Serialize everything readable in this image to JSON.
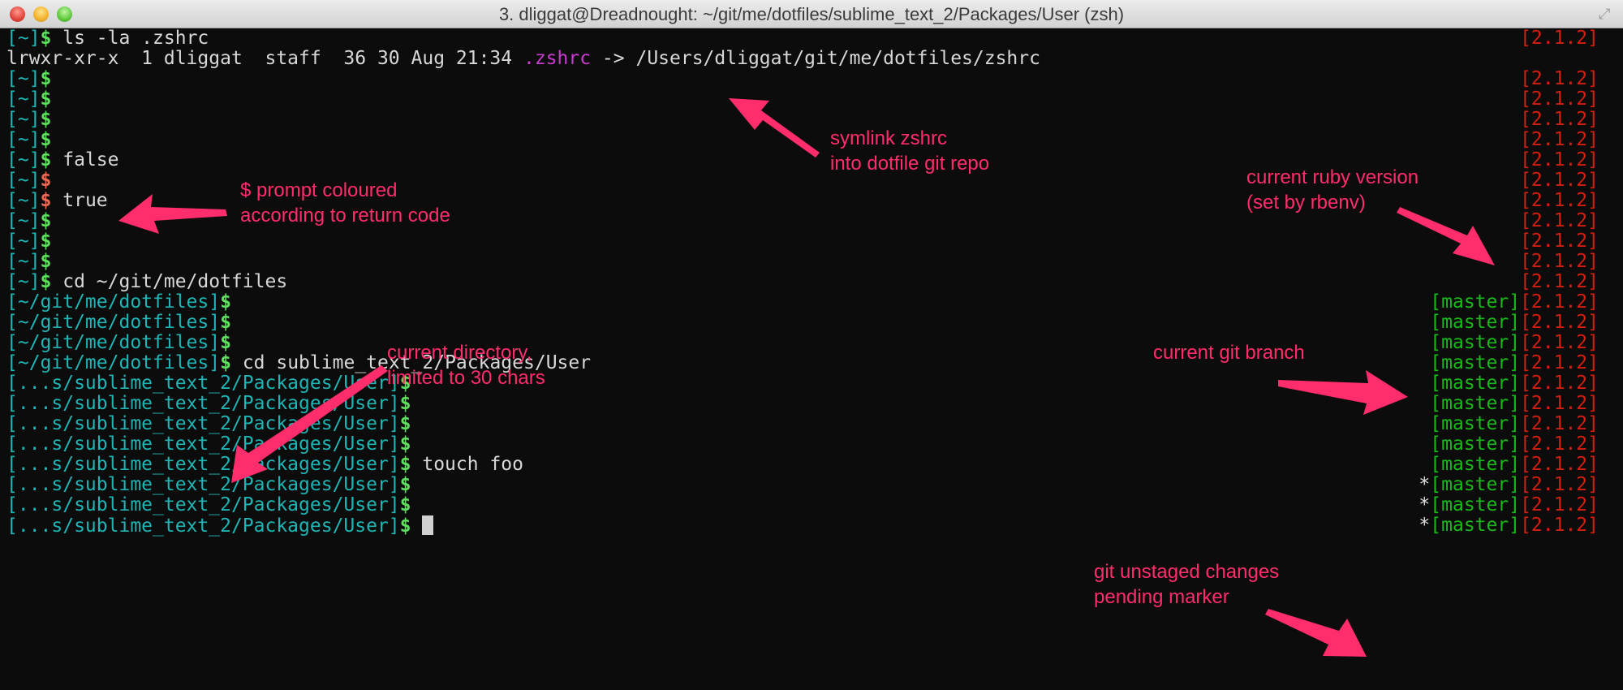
{
  "window": {
    "title": "3. dliggat@Dreadnought: ~/git/me/dotfiles/sublime_text_2/Packages/User (zsh)",
    "buttons": [
      "close",
      "minimize",
      "zoom"
    ]
  },
  "terminal": {
    "ruby_version": "[2.1.2]",
    "git_branch": "[master]",
    "dirty_marker": "*",
    "lines": [
      {
        "dir": "[~]",
        "sym": "$",
        "sym_color": "green",
        "cmd": " ls -la .zshrc",
        "branch": false,
        "dirty": false
      },
      {
        "output": "lrwxr-xr-x  1 dliggat  staff  36 30 Aug 21:34 ",
        "output_link": ".zshrc",
        "output_rest": " -> /Users/dliggat/git/me/dotfiles/zshrc",
        "no_right": true
      },
      {
        "dir": "[~]",
        "sym": "$",
        "sym_color": "green",
        "cmd": "",
        "branch": false,
        "dirty": false
      },
      {
        "dir": "[~]",
        "sym": "$",
        "sym_color": "green",
        "cmd": "",
        "branch": false,
        "dirty": false
      },
      {
        "dir": "[~]",
        "sym": "$",
        "sym_color": "green",
        "cmd": "",
        "branch": false,
        "dirty": false
      },
      {
        "dir": "[~]",
        "sym": "$",
        "sym_color": "green",
        "cmd": "",
        "branch": false,
        "dirty": false
      },
      {
        "dir": "[~]",
        "sym": "$",
        "sym_color": "green",
        "cmd": " false",
        "branch": false,
        "dirty": false
      },
      {
        "dir": "[~]",
        "sym": "$",
        "sym_color": "red",
        "cmd": "",
        "branch": false,
        "dirty": false
      },
      {
        "dir": "[~]",
        "sym": "$",
        "sym_color": "red",
        "cmd": " true",
        "branch": false,
        "dirty": false
      },
      {
        "dir": "[~]",
        "sym": "$",
        "sym_color": "green",
        "cmd": "",
        "branch": false,
        "dirty": false
      },
      {
        "dir": "[~]",
        "sym": "$",
        "sym_color": "green",
        "cmd": "",
        "branch": false,
        "dirty": false
      },
      {
        "dir": "[~]",
        "sym": "$",
        "sym_color": "green",
        "cmd": "",
        "branch": false,
        "dirty": false
      },
      {
        "dir": "[~]",
        "sym": "$",
        "sym_color": "green",
        "cmd": " cd ~/git/me/dotfiles",
        "branch": false,
        "dirty": false
      },
      {
        "dir": "[~/git/me/dotfiles]",
        "sym": "$",
        "sym_color": "green",
        "cmd": "",
        "branch": true,
        "dirty": false
      },
      {
        "dir": "[~/git/me/dotfiles]",
        "sym": "$",
        "sym_color": "green",
        "cmd": "",
        "branch": true,
        "dirty": false
      },
      {
        "dir": "[~/git/me/dotfiles]",
        "sym": "$",
        "sym_color": "green",
        "cmd": "",
        "branch": true,
        "dirty": false
      },
      {
        "dir": "[~/git/me/dotfiles]",
        "sym": "$",
        "sym_color": "green",
        "cmd": " cd sublime_text_2/Packages/User",
        "branch": true,
        "dirty": false
      },
      {
        "dir": "[...s/sublime_text_2/Packages/User]",
        "sym": "$",
        "sym_color": "green",
        "cmd": "",
        "branch": true,
        "dirty": false
      },
      {
        "dir": "[...s/sublime_text_2/Packages/User]",
        "sym": "$",
        "sym_color": "green",
        "cmd": "",
        "branch": true,
        "dirty": false
      },
      {
        "dir": "[...s/sublime_text_2/Packages/User]",
        "sym": "$",
        "sym_color": "green",
        "cmd": "",
        "branch": true,
        "dirty": false
      },
      {
        "dir": "[...s/sublime_text_2/Packages/User]",
        "sym": "$",
        "sym_color": "green",
        "cmd": "",
        "branch": true,
        "dirty": false
      },
      {
        "dir": "[...s/sublime_text_2/Packages/User]",
        "sym": "$",
        "sym_color": "green",
        "cmd": " touch foo",
        "branch": true,
        "dirty": false
      },
      {
        "dir": "[...s/sublime_text_2/Packages/User]",
        "sym": "$",
        "sym_color": "green",
        "cmd": "",
        "branch": true,
        "dirty": true
      },
      {
        "dir": "[...s/sublime_text_2/Packages/User]",
        "sym": "$",
        "sym_color": "green",
        "cmd": "",
        "branch": true,
        "dirty": true
      },
      {
        "dir": "[...s/sublime_text_2/Packages/User]",
        "sym": "$",
        "sym_color": "green",
        "cmd": " ",
        "branch": true,
        "dirty": true,
        "cursor": true
      }
    ]
  },
  "annotations": {
    "symlink": "symlink zshrc\ninto dotfile git repo",
    "prompt_color": "$ prompt coloured\naccording to return code",
    "ruby_version": "current ruby version\n(set by rbenv)",
    "directory": "current directory,\nlimited to 30 chars",
    "git_branch": "current git branch",
    "git_dirty": "git unstaged changes\npending marker"
  },
  "colors": {
    "background": "#0c0c0c",
    "dir": "#1fb5b5",
    "prompt_ok": "#5fe05f",
    "prompt_err": "#f06a55",
    "branch": "#1bb81b",
    "ruby": "#d41f10",
    "annotation": "#ff2d6c"
  }
}
